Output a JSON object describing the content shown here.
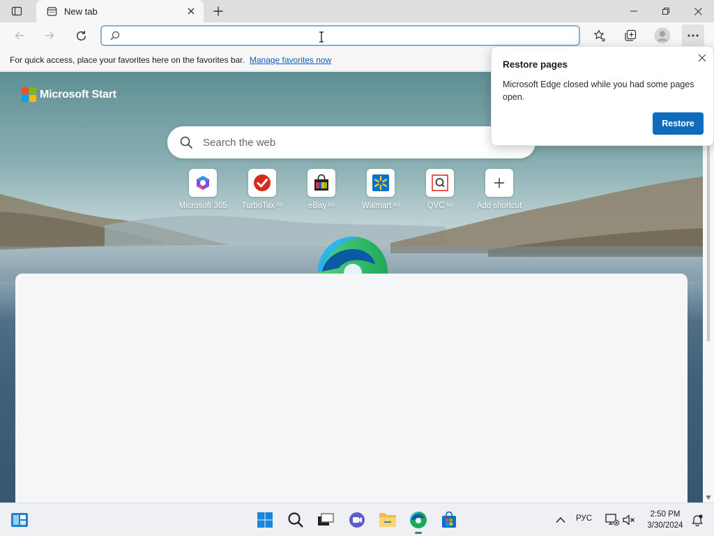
{
  "browser": {
    "tab": {
      "title": "New tab"
    },
    "address": {
      "value": "",
      "placeholder": ""
    }
  },
  "favorites_bar": {
    "message": "For quick access, place your favorites here on the favorites bar.",
    "link": "Manage favorites now"
  },
  "newtab": {
    "brand": "Microsoft Start",
    "search_placeholder": "Search the web",
    "shortcuts": [
      {
        "label": "Microsoft 365",
        "ad": ""
      },
      {
        "label": "TurboTax",
        "ad": "Ad"
      },
      {
        "label": "eBay",
        "ad": "Ad"
      },
      {
        "label": "Walmart",
        "ad": "Ad"
      },
      {
        "label": "QVC",
        "ad": "Ad"
      },
      {
        "label": "Add shortcut",
        "ad": ""
      }
    ]
  },
  "restore_popup": {
    "title": "Restore pages",
    "message": "Microsoft Edge closed while you had some pages open.",
    "button": "Restore"
  },
  "taskbar": {
    "language": "РУС",
    "time": "2:50 PM",
    "date": "3/30/2024"
  },
  "colors": {
    "accent": "#0f6cbd",
    "link": "#0f5ab8",
    "ms_red": "#f25022",
    "ms_green": "#7fba00",
    "ms_blue": "#00a4ef",
    "ms_yellow": "#ffb900"
  }
}
